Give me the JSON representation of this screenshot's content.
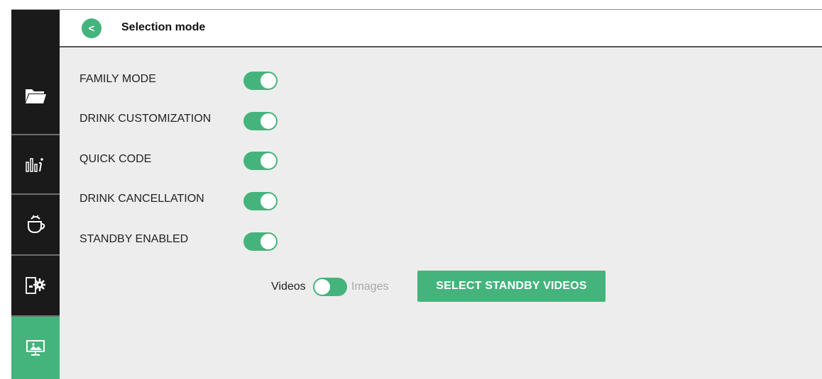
{
  "header": {
    "back_label": "<",
    "title": "Selection mode"
  },
  "sidebar": {
    "items": [
      {
        "icon": "folder-icon"
      },
      {
        "icon": "statistics-icon"
      },
      {
        "icon": "coffee-cup-icon"
      },
      {
        "icon": "machine-settings-icon"
      },
      {
        "icon": "screen-icon",
        "active": true
      }
    ]
  },
  "settings": {
    "rows": [
      {
        "label": "FAMILY MODE",
        "enabled": true
      },
      {
        "label": "DRINK CUSTOMIZATION",
        "enabled": true
      },
      {
        "label": "QUICK CODE",
        "enabled": true
      },
      {
        "label": "DRINK CANCELLATION",
        "enabled": true
      },
      {
        "label": "STANDBY ENABLED",
        "enabled": true
      }
    ]
  },
  "standby": {
    "left_option": "Videos",
    "right_option": "Images",
    "selected": "Videos",
    "button_label": "SELECT STANDBY VIDEOS"
  },
  "colors": {
    "accent": "#44b47c",
    "sidebar": "#1a1a1a",
    "background": "#ededed"
  }
}
